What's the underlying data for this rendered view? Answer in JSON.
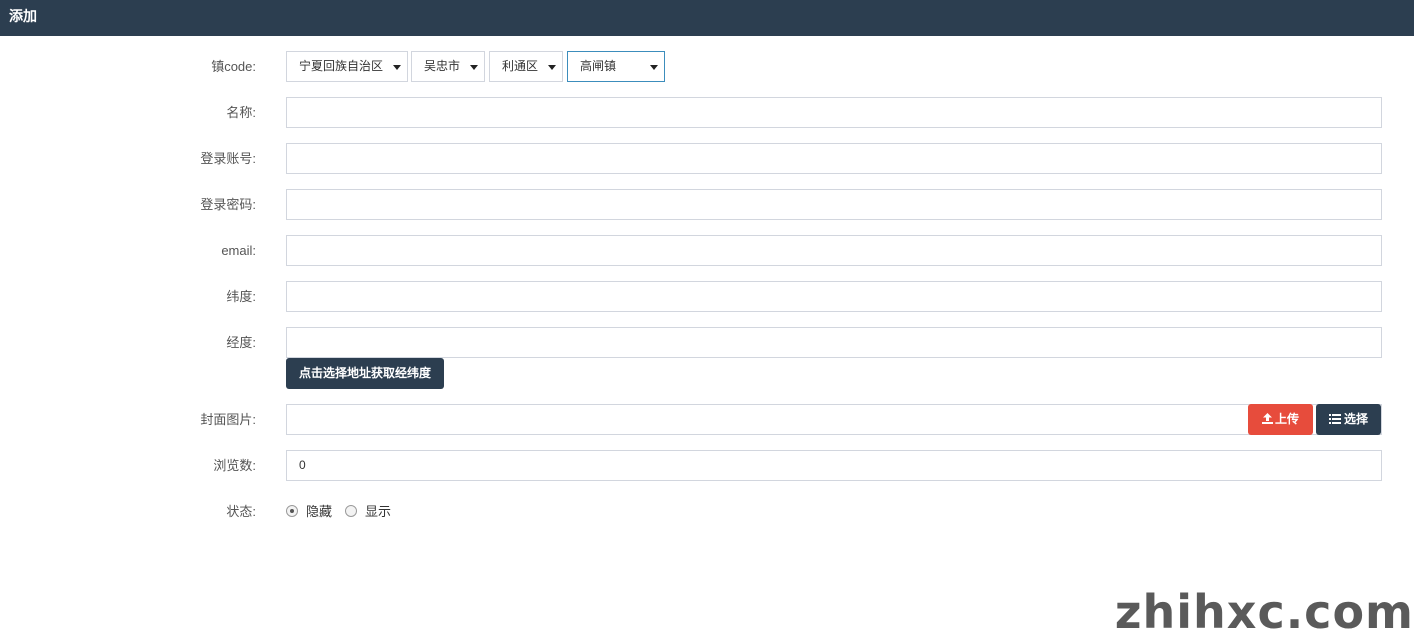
{
  "header": {
    "title": "添加"
  },
  "form": {
    "town_code": {
      "label": "镇code:",
      "selects": [
        "宁夏回族自治区",
        "吴忠市",
        "利通区",
        "高闸镇"
      ]
    },
    "name": {
      "label": "名称:",
      "value": ""
    },
    "login_account": {
      "label": "登录账号:",
      "value": ""
    },
    "login_password": {
      "label": "登录密码:",
      "value": ""
    },
    "email": {
      "label": "email:",
      "value": ""
    },
    "latitude": {
      "label": "纬度:",
      "value": ""
    },
    "longitude": {
      "label": "经度:",
      "value": ""
    },
    "pick_location_button": "点击选择地址获取经纬度",
    "cover_image": {
      "label": "封面图片:",
      "value": "",
      "upload_button": "上传",
      "select_button": "选择"
    },
    "views": {
      "label": "浏览数:",
      "value": "0"
    },
    "status": {
      "label": "状态:",
      "options": [
        "隐藏",
        "显示"
      ],
      "selected": "隐藏"
    }
  },
  "watermark": "zhihxc.com"
}
